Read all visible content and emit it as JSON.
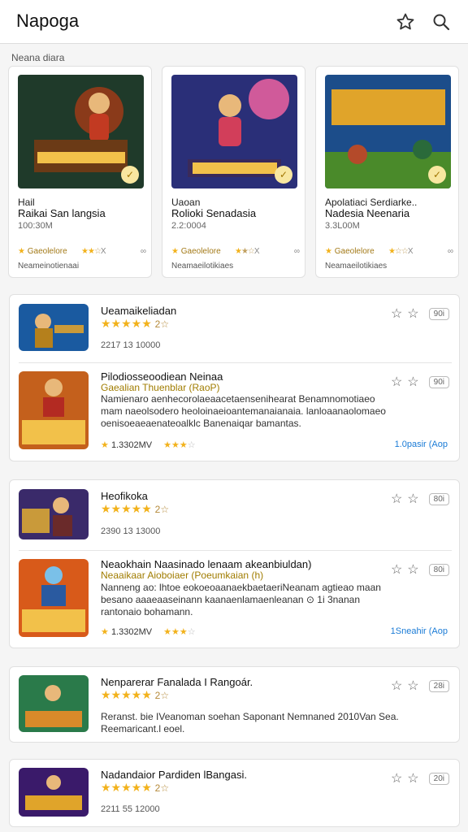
{
  "appbar": {
    "title": "Napoga",
    "star_icon": "star-outline-icon",
    "search_icon": "search-icon"
  },
  "section": {
    "label": "Neana diara"
  },
  "featured": [
    {
      "l1": "Hail",
      "l2": "Raikai San langsia",
      "l3": "100:30M",
      "badge": "Gaeolelore",
      "stars": "★★",
      "stars_off": "☆",
      "x": "X",
      "l4": "Neameinotienaai",
      "colors": [
        "#1f3a2a",
        "#b6551c"
      ]
    },
    {
      "l1": "Uaoan",
      "l2": "Rolioki Senadasia",
      "l3": "2.2:0004",
      "badge": "Gaeolelore",
      "stars": "★",
      "stars_off": "★☆",
      "x": "X",
      "l4": "Neamaeilotikiaes",
      "colors": [
        "#2a2f78",
        "#d23e5a"
      ]
    },
    {
      "l1": "Apolatiaci Serdiarke..",
      "l2": "Nadesia Neenaria",
      "l3": "3.3L00M",
      "badge": "Gaeolelore",
      "stars": "★",
      "stars_off": "☆☆",
      "x": "X",
      "l4": "Neamaeilotikiaes",
      "colors": [
        "#1c4d8a",
        "#e0a42a"
      ]
    }
  ],
  "cards": [
    {
      "items": [
        {
          "title": "Ueamaikeliadan",
          "stars": "★★★★★",
          "extra": "2☆",
          "meta": "2217 13 10000",
          "pill": "90i"
        },
        {
          "title": "Pilodiosseoodiean Neinaa",
          "subtitle": "Gaealian Thuenblar (RaoP)",
          "desc": "Namienaro aenhecorolaeaacetaensenihearat Benamnomotiaeo mam naeolsodero heoloinaeioantemanaianaia. lanloaanaolomaeo oenisoeaeaenateoalklc Banenaiqar bamantas.",
          "rating": "1.3302MV",
          "stars2": "★★★",
          "stars2_off": "☆",
          "cta": "1.0pasir (Aop",
          "pill": "90i"
        }
      ]
    },
    {
      "items": [
        {
          "title": "Heofikoka",
          "stars": "★★★★★",
          "extra": "2☆",
          "meta": "2390 13 13000",
          "pill": "80i"
        },
        {
          "title": "Neaokhain Naasinado lenaam akeanbiuldan)",
          "subtitle": "Neaaikaar Aioboiaer (Poeumkaian (h)",
          "desc": "Nanneng ao: lhtoe eokoeoaanaekbaetaeriNeanam agtieao maan besano aaaeaaseinann kaanaenlamaenleanan ⊙ 1i 3nanan rantonaio bohamann.",
          "rating": "1.3302MV",
          "stars2": "★★★",
          "stars2_off": "☆",
          "cta": "1Sneahir (Aop",
          "pill": "80i"
        }
      ]
    },
    {
      "items": [
        {
          "title": "Nenparerar Fanalada I Rangoár.",
          "stars": "★★★★★",
          "extra": "2☆",
          "desc": "Reranst. bie IVeanoman soehan Saponant Nemnaned 2010Van Sea. Reemaricant.l eoel.",
          "pill": "28i"
        }
      ]
    },
    {
      "items": [
        {
          "title": "Nadandaior Pardiden lBangasi.",
          "stars": "★★★★★",
          "extra": "2☆",
          "meta": "2211 55 12000",
          "pill": "20i"
        }
      ]
    }
  ]
}
